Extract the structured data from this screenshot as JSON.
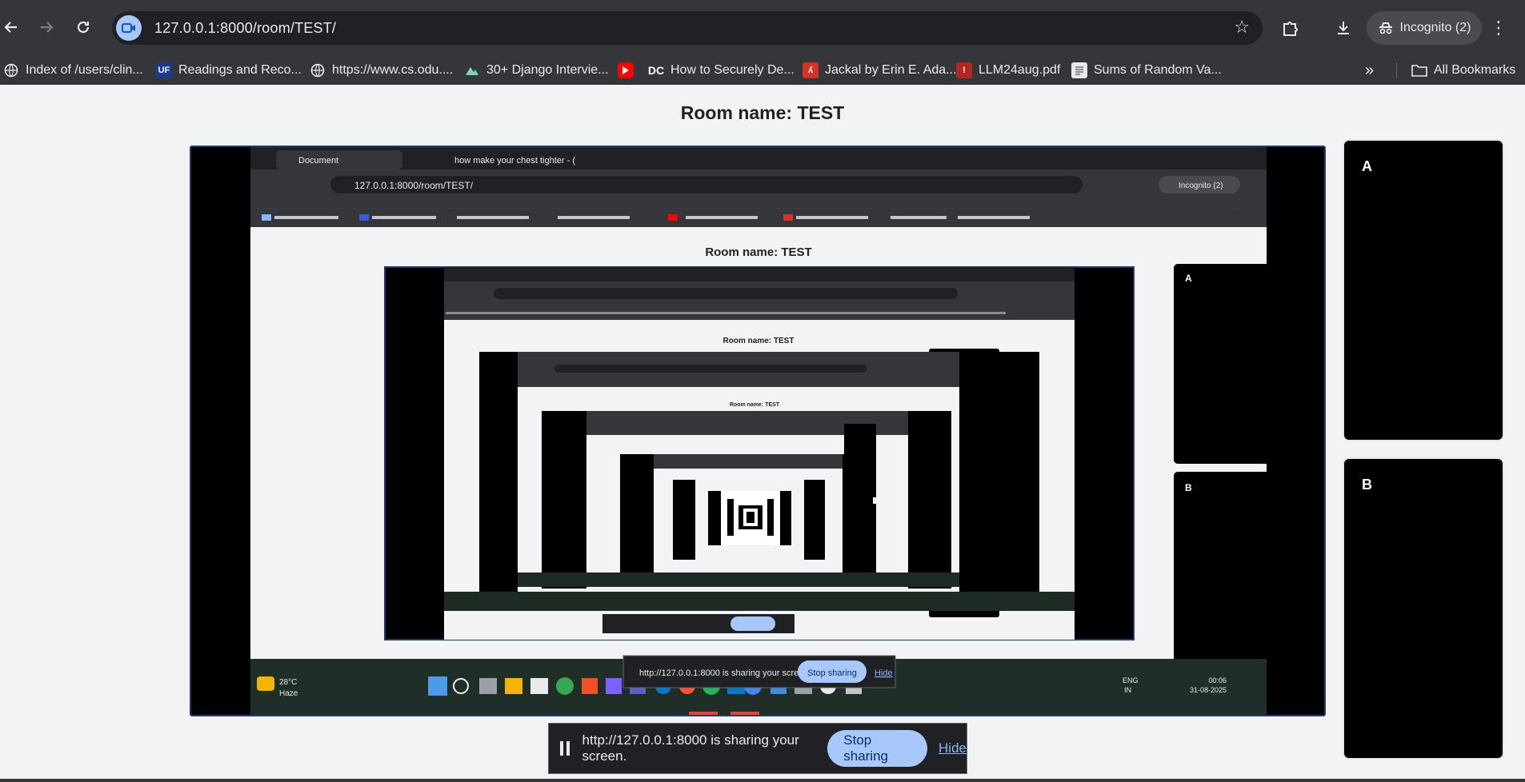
{
  "browser": {
    "url": "127.0.0.1:8000/room/TEST/",
    "profile_label": "Incognito (2)",
    "bookmarks": [
      {
        "label": "Index of /users/clin...",
        "icon": "globe-icon"
      },
      {
        "label": "Readings and Reco...",
        "icon": "uf-logo-icon"
      },
      {
        "label": "https://www.cs.odu....",
        "icon": "globe-icon"
      },
      {
        "label": "30+ Django Intervie...",
        "icon": "mountain-icon"
      },
      {
        "label": "",
        "icon": "youtube-icon"
      },
      {
        "label": "How to Securely De...",
        "icon": "dc-logo-icon"
      },
      {
        "label": "Jackal by Erin E. Ada...",
        "icon": "pdf-icon"
      },
      {
        "label": "LLM24aug.pdf",
        "icon": "pdf-icon"
      },
      {
        "label": "Sums of Random Va...",
        "icon": "document-icon"
      }
    ],
    "all_bookmarks_label": "All Bookmarks"
  },
  "page": {
    "room_title": "Room name: TEST",
    "participants": [
      {
        "label": "A"
      },
      {
        "label": "B"
      }
    ]
  },
  "inner": {
    "tabs": [
      {
        "label": "Document"
      },
      {
        "label": "how make your chest tighter - ("
      }
    ],
    "url": "127.0.0.1:8000/room/TEST/",
    "profile_label": "Incognito (2)",
    "weather_temp": "28°C",
    "weather_cond": "Haze",
    "lang_1": "ENG",
    "lang_2": "IN",
    "time": "00:06",
    "date": "31-08-2025"
  },
  "share_bar": {
    "message": "http://127.0.0.1:8000 is sharing your screen.",
    "stop_label": "Stop sharing",
    "hide_label": "Hide"
  }
}
